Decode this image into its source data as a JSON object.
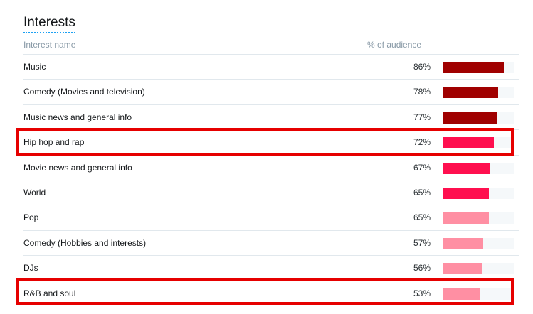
{
  "title": "Interests",
  "columns": {
    "name": "Interest name",
    "pct": "% of audience"
  },
  "rows": [
    {
      "name": "Music",
      "pct_label": "86%",
      "value": 86,
      "color": "#a00000"
    },
    {
      "name": "Comedy (Movies and television)",
      "pct_label": "78%",
      "value": 78,
      "color": "#a00000"
    },
    {
      "name": "Music news and general info",
      "pct_label": "77%",
      "value": 77,
      "color": "#a00000"
    },
    {
      "name": "Hip hop and rap",
      "pct_label": "72%",
      "value": 72,
      "color": "#ff0f4f"
    },
    {
      "name": "Movie news and general info",
      "pct_label": "67%",
      "value": 67,
      "color": "#ff0f4f"
    },
    {
      "name": "World",
      "pct_label": "65%",
      "value": 65,
      "color": "#ff0f4f"
    },
    {
      "name": "Pop",
      "pct_label": "65%",
      "value": 65,
      "color": "#ff8fa3"
    },
    {
      "name": "Comedy (Hobbies and interests)",
      "pct_label": "57%",
      "value": 57,
      "color": "#ff8fa3"
    },
    {
      "name": "DJs",
      "pct_label": "56%",
      "value": 56,
      "color": "#ff8fa3"
    },
    {
      "name": "R&B and soul",
      "pct_label": "53%",
      "value": 53,
      "color": "#ff8fa3"
    }
  ],
  "highlight_color": "#e60000"
}
